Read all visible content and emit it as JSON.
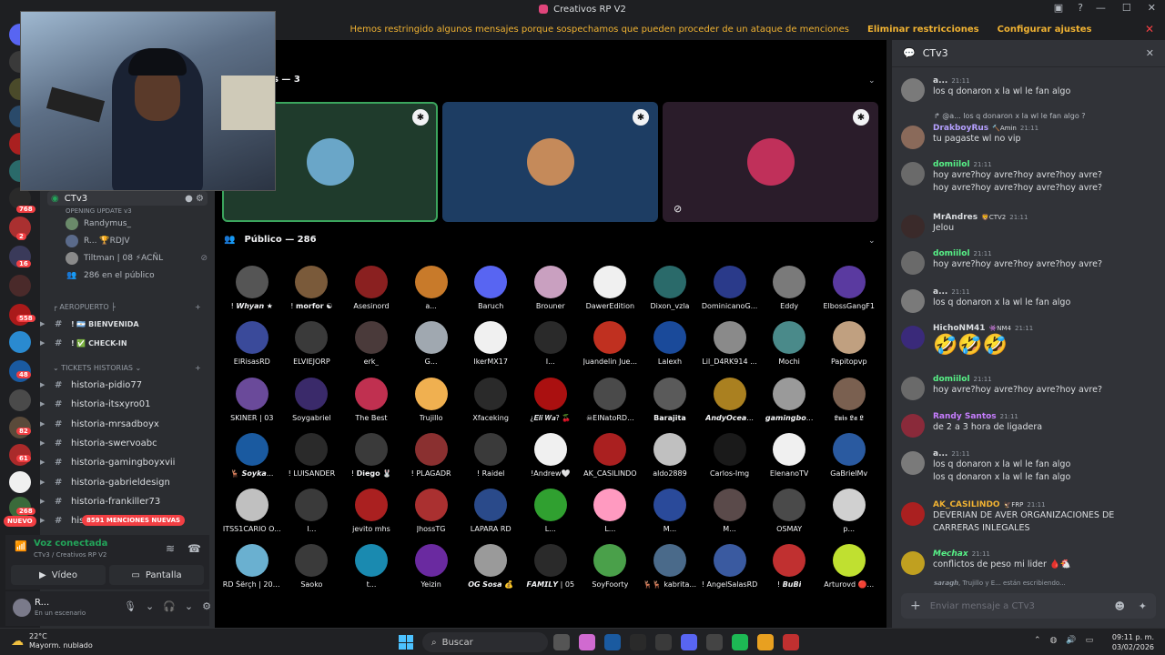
{
  "window": {
    "title": "Creativos RP V2"
  },
  "banner": {
    "message": "Hemos restringido algunos mensajes porque sospechamos que pueden proceder de un ataque de menciones",
    "action1": "Eliminar restricciones",
    "action2": "Configurar ajustes"
  },
  "rail": {
    "badges": [
      "768",
      "2",
      "16",
      "558",
      "48",
      "82",
      "61",
      "268"
    ],
    "nuevo": "NUEVO"
  },
  "sidebar": {
    "voice_channel": "CTv3",
    "voice_sub": "OPENING UPDATE v3",
    "voice_users": [
      {
        "name": "Randymus_"
      },
      {
        "name": "R... 🏆RDJV"
      },
      {
        "name": "Tiltman | 08 ⚡ACÑL"
      }
    ],
    "public_count": "286 en el público",
    "category1": "AEROPUERTO",
    "channels1": [
      {
        "name": "! 🇦🇷 BIENVENIDA"
      },
      {
        "name": "! ✅ CHECK-IN"
      }
    ],
    "category2": "TICKETS HISTORIAS",
    "channels2": [
      {
        "name": "historia-pidio77"
      },
      {
        "name": "historia-itsxyro01"
      },
      {
        "name": "historia-mrsadboyx"
      },
      {
        "name": "historia-swervoabc"
      },
      {
        "name": "historia-gamingboyxvii"
      },
      {
        "name": "historia-gabrieldesign"
      },
      {
        "name": "historia-frankiller73"
      },
      {
        "name": "hist"
      }
    ],
    "mentions_pill": "8591 MENCIONES NUEVAS"
  },
  "voice_panel": {
    "status": "Voz conectada",
    "location": "CTv3 / Creativos RP V2",
    "video_label": "Vídeo",
    "screen_label": "Pantalla"
  },
  "user_panel": {
    "name": "R...",
    "status": "En un escenario"
  },
  "stage": {
    "speakers_header": "s — 3",
    "public_header": "Público — 286",
    "tiles": [
      {
        "bg": "#1f3b2c",
        "border": "#3ba55d",
        "av": "#6aa6c8"
      },
      {
        "bg": "#1d3d63",
        "border": "#1d3d63",
        "av": "#c58a5a"
      },
      {
        "bg": "#2a1c2a",
        "border": "#2a1c2a",
        "av": "#c0305a"
      }
    ],
    "audience": [
      "! 𝙒𝙝𝙮𝙖𝙣 ★",
      "! 𝗺𝗼𝗿𝗳𝗼𝗿 ☯",
      "Asesinord",
      "a...",
      "Baruch",
      "Brouner",
      "DawerEdition",
      "Dixon_vzla",
      "DominicanoG...",
      "Eddy",
      "ElbossGangF1",
      "ElRisasRD",
      "ELVIEJORP",
      "erk_",
      "G...",
      "IkerMX17",
      "I...",
      "Juandelin Jue...",
      "Lalexh",
      "Lil_D4RK914 ...",
      "Mochi",
      "Papitopvp",
      "SKINER | 03",
      "Soygabriel",
      "The Best",
      "Trujillo",
      "Xfaceking",
      "¿𝑬𝒍𝒊 𝑾𝒂? 🍒",
      "☠ElNatoRD...",
      "𝗕𝗮𝗿𝗮𝗷𝗶𝘁𝗮",
      "𝘼𝙣𝙙𝙮𝙊𝙘𝙚𝙖...",
      "𝙜𝙖𝙢𝙞𝙣𝙜𝙗𝙤...",
      "𝕷𝖚𝖎𝖘 𝕷𝖆 𝕷",
      "🦌 𝙎𝙤𝙮𝙠𝙖...",
      "! LUISANDER",
      "! 𝗗𝗶𝗲𝗴𝗼 🐰",
      "! PLAGADR",
      "! Raidel",
      "!Andrew🤍",
      "AK_CASILINDO",
      "aldo2889",
      "Carlos-Img",
      "ElenanoTV",
      "GaBrielMv",
      "ITSS1CARIO O...",
      "I...",
      "jevito mhs",
      "JhossTG",
      "LAPARA RD",
      "L...",
      "L...",
      "M...",
      "M...",
      "OSMAY",
      "p...",
      "RD Šërçh | 20 ...",
      "Saoko",
      "t...",
      "Yeizin",
      "𝙊𝙂 𝙎𝙤𝙨𝙖 💰",
      "𝙁𝘼𝙈𝙄𝙇𝙔 | 05",
      "SoyFoorty",
      "🦌🦌 kabrita...",
      "! AngelSalasRD",
      "! 𝘽𝙪𝘽𝙞",
      "Arturovd 🔴..."
    ],
    "audience_colors": [
      "#555",
      "#7a5a3a",
      "#8a2020",
      "#c87a2a",
      "#5865f2",
      "#c9a0c0",
      "#f0f0f0",
      "#2a6a6a",
      "#2a3a8a",
      "#7a7a7a",
      "#5a3aa0",
      "#3a4a9a",
      "#3a3a3a",
      "#4a3a3a",
      "#a0a8b0",
      "#f0f0f0",
      "#2a2a2a",
      "#c03020",
      "#1a4a9a",
      "#8a8a8a",
      "#4a8a8a",
      "#c0a080",
      "#6a4a9a",
      "#3a2a6a",
      "#c03050",
      "#f0b050",
      "#2a2a2a",
      "#aa1010",
      "#4a4a4a",
      "#5a5a5a",
      "#aa8020",
      "#9a9a9a",
      "#7a6050",
      "#1a5aa0",
      "#2a2a2a",
      "#3a3a3a",
      "#8a3030",
      "#3a3a3a",
      "#f0f0f0",
      "#aa2020",
      "#c0c0c0",
      "#1a1a1a",
      "#f0f0f0",
      "#2a5aa0",
      "#c0c0c0",
      "#3a3a3a",
      "#aa2020",
      "#aa3030",
      "#2a4a8a",
      "#30a030",
      "#ff9ac0",
      "#2a4a9a",
      "#5a4a4a",
      "#4a4a4a",
      "#d0d0d0",
      "#6ab0d0",
      "#3a3a3a",
      "#1a8ab0",
      "#6a2aa0",
      "#9a9a9a",
      "#2a2a2a",
      "#4aa04a",
      "#4a6a8a",
      "#3a5aa0",
      "#c03030",
      "#c0e030"
    ]
  },
  "chat": {
    "title": "CTv3",
    "messages": [
      {
        "user": "a...",
        "color": "#dbdee1",
        "time": "21:11",
        "lines": [
          "los q donaron x la wl le fan algo"
        ],
        "av": "#7a7a7a"
      },
      {
        "user": "DrakboyRus",
        "color": "#b5a0ff",
        "tag": "🔨Amin",
        "time": "21:11",
        "lines": [
          "tu pagaste wl no vip"
        ],
        "av": "#8a6a5a"
      },
      {
        "user": "domiilol",
        "color": "#57f287",
        "time": "21:11",
        "lines": [
          "hoy avre?hoy avre?hoy avre?hoy avre?",
          "hoy avre?hoy avre?hoy avre?hoy avre?"
        ],
        "av": "#6a6a6a"
      },
      {
        "user": "MrAndres",
        "color": "#dbdee1",
        "tag": "🦁CTV2",
        "time": "21:11",
        "lines": [
          "Jelou"
        ],
        "av": "#3a2a2a"
      },
      {
        "user": "domiilol",
        "color": "#57f287",
        "time": "21:11",
        "lines": [
          "hoy avre?hoy avre?hoy avre?hoy avre?"
        ],
        "av": "#6a6a6a"
      },
      {
        "user": "a...",
        "color": "#dbdee1",
        "time": "21:11",
        "lines": [
          "los q donaron x la wl le fan algo"
        ],
        "av": "#7a7a7a"
      },
      {
        "user": "HichoNM41",
        "color": "#dbdee1",
        "tag": "👾NM4",
        "time": "21:11",
        "lines": [
          "🤣🤣🤣"
        ],
        "av": "#3a2a7a"
      },
      {
        "user": "domiilol",
        "color": "#57f287",
        "time": "21:11",
        "lines": [
          "hoy avre?hoy avre?hoy avre?hoy avre?"
        ],
        "av": "#6a6a6a"
      },
      {
        "user": "Randy Santos",
        "color": "#c77dff",
        "time": "21:11",
        "lines": [
          "de 2 a 3 hora de ligadera"
        ],
        "av": "#8a2a3a"
      },
      {
        "user": "a...",
        "color": "#dbdee1",
        "time": "21:11",
        "lines": [
          "los q donaron x la wl le fan algo",
          "los q donaron x la wl le fan algo"
        ],
        "av": "#7a7a7a"
      },
      {
        "user": "AK_CASILINDO",
        "color": "#f0b232",
        "tag": "🦅FRP",
        "time": "21:11",
        "lines": [
          "DEVERIAN DE AVER ORGANIZACIONES DE",
          "CARRERAS INLEGALES"
        ],
        "av": "#aa2020"
      },
      {
        "user": "𝙈𝙚𝙘𝙝𝙖𝙭",
        "color": "#57f287",
        "time": "21:11",
        "lines": [
          "conflictos de peso mi lider 🩸🐔"
        ],
        "av": "#c0a020"
      }
    ],
    "reply_preview": "@a... los q donaron x la wl le fan algo ?",
    "typing": "𝙨𝙖𝙧𝙖𝙜𝙝, Trujillo y E... están escribiendo...",
    "placeholder": "Enviar mensaje a CTv3"
  },
  "taskbar": {
    "temp": "22°C",
    "weather": "Mayorm. nublado",
    "search": "Buscar",
    "time": "09:11 p. m.",
    "date": "03/02/2026"
  }
}
